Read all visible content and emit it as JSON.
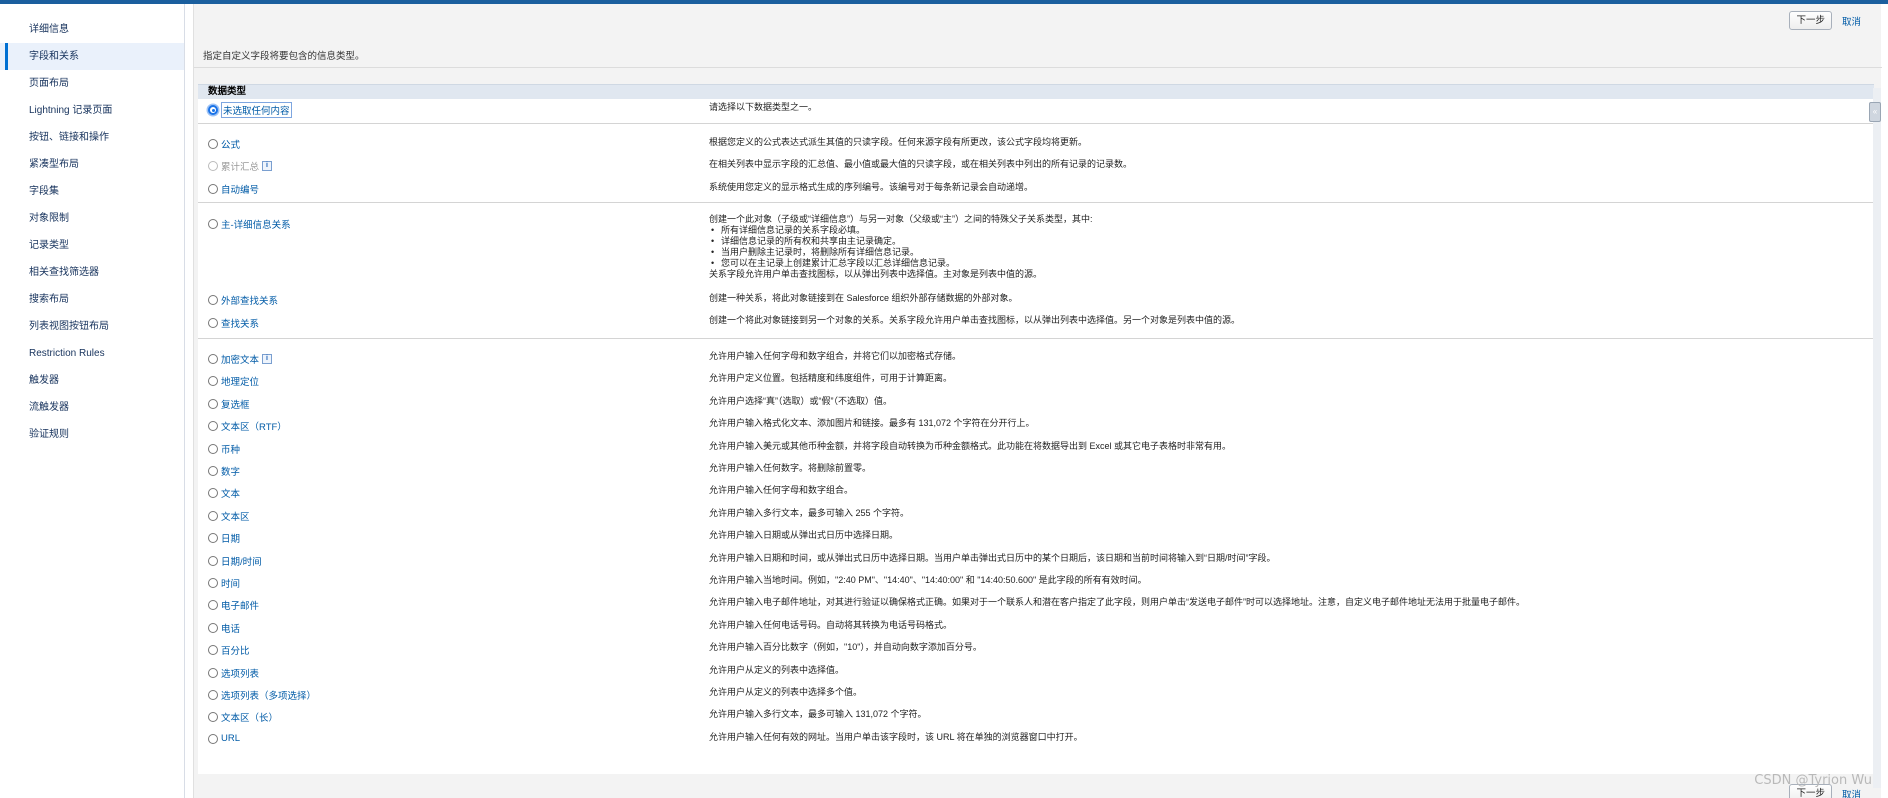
{
  "sidebar": {
    "items": [
      {
        "label": "详细信息",
        "active": false
      },
      {
        "label": "字段和关系",
        "active": true
      },
      {
        "label": "页面布局",
        "active": false
      },
      {
        "label": "Lightning 记录页面",
        "active": false
      },
      {
        "label": "按钮、链接和操作",
        "active": false
      },
      {
        "label": "紧凑型布局",
        "active": false
      },
      {
        "label": "字段集",
        "active": false
      },
      {
        "label": "对象限制",
        "active": false
      },
      {
        "label": "记录类型",
        "active": false
      },
      {
        "label": "相关查找筛选器",
        "active": false
      },
      {
        "label": "搜索布局",
        "active": false
      },
      {
        "label": "列表视图按钮布局",
        "active": false
      },
      {
        "label": "Restriction Rules",
        "active": false
      },
      {
        "label": "触发器",
        "active": false
      },
      {
        "label": "流触发器",
        "active": false
      },
      {
        "label": "验证规则",
        "active": false
      }
    ]
  },
  "toolbar": {
    "next_label": "下一步",
    "cancel_label": "取消"
  },
  "instruction": "指定自定义字段将要包含的信息类型。",
  "section": {
    "title": "数据类型"
  },
  "options": {
    "none": {
      "label": "未选取任何内容",
      "desc": "请选择以下数据类型之一。"
    },
    "formula": {
      "label": "公式",
      "desc": "根据您定义的公式表达式派生其值的只读字段。任何来源字段有所更改，该公式字段均将更新。"
    },
    "rollup": {
      "label": "累计汇总",
      "desc": "在相关列表中显示字段的汇总值、最小值或最大值的只读字段，或在相关列表中列出的所有记录的记录数。"
    },
    "autonumber": {
      "label": "自动编号",
      "desc": "系统使用您定义的显示格式生成的序列编号。该编号对于每条新记录会自动递增。"
    },
    "masterdetail": {
      "label": "主-详细信息关系",
      "desc_intro": "创建一个此对象（子级或“详细信息”）与另一对象（父级或“主”）之间的特殊父子关系类型，其中:",
      "bullets": [
        "所有详细信息记录的关系字段必填。",
        "详细信息记录的所有权和共享由主记录确定。",
        "当用户删除主记录时，将删除所有详细信息记录。",
        "您可以在主记录上创建累计汇总字段以汇总详细信息记录。"
      ],
      "desc_outro": "关系字段允许用户单击查找图标，以从弹出列表中选择值。主对象是列表中值的源。"
    },
    "externallookup": {
      "label": "外部查找关系",
      "desc": "创建一种关系，将此对象链接到在 Salesforce 组织外部存储数据的外部对象。"
    },
    "lookup": {
      "label": "查找关系",
      "desc": "创建一个将此对象链接到另一个对象的关系。关系字段允许用户单击查找图标，以从弹出列表中选择值。另一个对象是列表中值的源。"
    }
  },
  "types": [
    {
      "label": "加密文本",
      "info": true,
      "desc": "允许用户输入任何字母和数字组合，并将它们以加密格式存储。"
    },
    {
      "label": "地理定位",
      "info": false,
      "desc": "允许用户定义位置。包括精度和纬度组件，可用于计算距离。"
    },
    {
      "label": "复选框",
      "info": false,
      "desc": "允许用户选择“真”（选取）或“假”（不选取）值。"
    },
    {
      "label": "文本区（RTF）",
      "info": false,
      "desc": "允许用户输入格式化文本、添加图片和链接。最多有 131,072 个字符在分开行上。"
    },
    {
      "label": "币种",
      "info": false,
      "desc": "允许用户输入美元或其他币种金额，并将字段自动转换为币种金额格式。此功能在将数据导出到 Excel 或其它电子表格时非常有用。"
    },
    {
      "label": "数字",
      "info": false,
      "desc": "允许用户输入任何数字。将删除前置零。"
    },
    {
      "label": "文本",
      "info": false,
      "desc": "允许用户输入任何字母和数字组合。"
    },
    {
      "label": "文本区",
      "info": false,
      "desc": "允许用户输入多行文本，最多可输入 255 个字符。"
    },
    {
      "label": "日期",
      "info": false,
      "desc": "允许用户输入日期或从弹出式日历中选择日期。"
    },
    {
      "label": "日期/时间",
      "info": false,
      "desc": "允许用户输入日期和时间，或从弹出式日历中选择日期。当用户单击弹出式日历中的某个日期后，该日期和当前时间将输入到“日期/时间”字段。"
    },
    {
      "label": "时间",
      "info": false,
      "desc": "允许用户输入当地时间。例如，\"2:40 PM\"、\"14:40\"、\"14:40:00\" 和 \"14:40:50.600\" 是此字段的所有有效时间。"
    },
    {
      "label": "电子邮件",
      "info": false,
      "desc": "允许用户输入电子邮件地址，对其进行验证以确保格式正确。如果对于一个联系人和潜在客户指定了此字段，则用户单击“发送电子邮件”时可以选择地址。注意，自定义电子邮件地址无法用于批量电子邮件。"
    },
    {
      "label": "电话",
      "info": false,
      "desc": "允许用户输入任何电话号码。自动将其转换为电话号码格式。"
    },
    {
      "label": "百分比",
      "info": false,
      "desc": "允许用户输入百分比数字（例如，\"10\"），并自动向数字添加百分号。"
    },
    {
      "label": "选项列表",
      "info": false,
      "desc": "允许用户从定义的列表中选择值。"
    },
    {
      "label": "选项列表（多项选择）",
      "info": false,
      "desc": "允许用户从定义的列表中选择多个值。"
    },
    {
      "label": "文本区（长）",
      "info": false,
      "desc": "允许用户输入多行文本，最多可输入 131,072 个字符。"
    },
    {
      "label": "URL",
      "info": false,
      "desc": "允许用户输入任何有效的网址。当用户单击该字段时，该 URL 将在单独的浏览器窗口中打开。"
    }
  ],
  "info_glyph": "i",
  "scroll_glyph": "«",
  "watermark": "CSDN @Tyrion Wu",
  "colors": {
    "accent": "#0070d2",
    "link": "#015ba7",
    "header_bg": "#e0e7f0"
  }
}
